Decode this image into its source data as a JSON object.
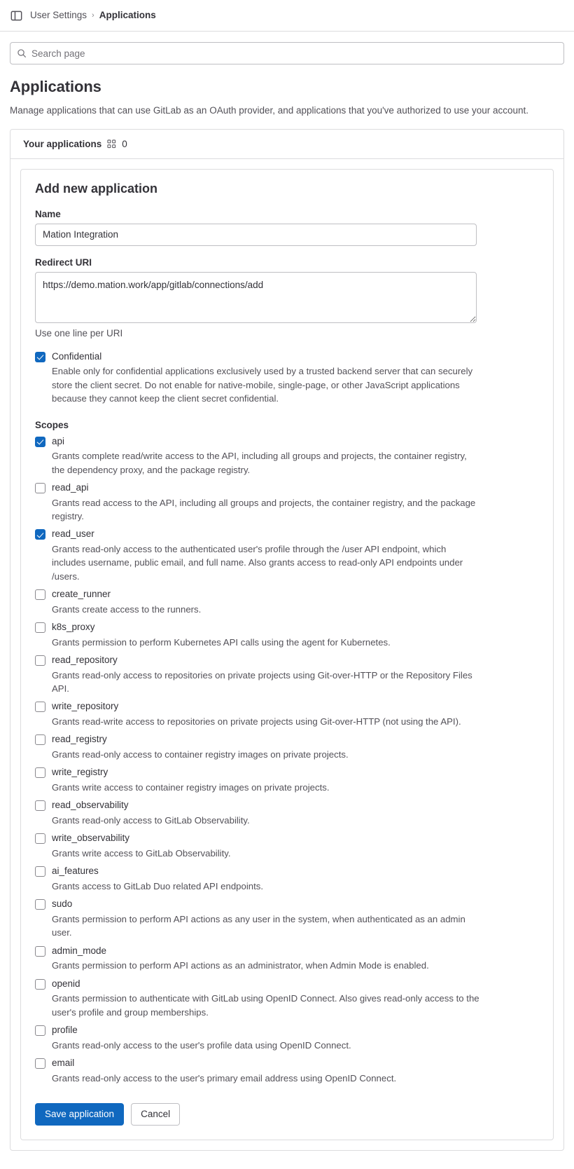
{
  "topbar": {
    "sidebar_toggle_icon": "sidebar-panel-icon",
    "breadcrumb": {
      "parent": "User Settings",
      "separator": "›",
      "current": "Applications"
    }
  },
  "search": {
    "icon": "search-icon",
    "placeholder": "Search page",
    "value": ""
  },
  "page": {
    "title": "Applications",
    "description": "Manage applications that can use GitLab as an OAuth provider, and applications that you've authorized to use your account."
  },
  "card": {
    "header_label": "Your applications",
    "header_icon": "applications-grid-icon",
    "count": "0"
  },
  "form": {
    "title": "Add new application",
    "name_label": "Name",
    "name_value": "Mation Integration",
    "name_placeholder": "",
    "redirect_label": "Redirect URI",
    "redirect_value": "https://demo.mation.work/app/gitlab/connections/add",
    "redirect_placeholder": "",
    "redirect_help": "Use one line per URI",
    "confidential": {
      "label": "Confidential",
      "checked": true,
      "description": "Enable only for confidential applications exclusively used by a trusted backend server that can securely store the client secret. Do not enable for native-mobile, single-page, or other JavaScript applications because they cannot keep the client secret confidential."
    },
    "scopes_label": "Scopes",
    "scopes": [
      {
        "name": "api",
        "checked": true,
        "description": "Grants complete read/write access to the API, including all groups and projects, the container registry, the dependency proxy, and the package registry."
      },
      {
        "name": "read_api",
        "checked": false,
        "description": "Grants read access to the API, including all groups and projects, the container registry, and the package registry."
      },
      {
        "name": "read_user",
        "checked": true,
        "description": "Grants read-only access to the authenticated user's profile through the /user API endpoint, which includes username, public email, and full name. Also grants access to read-only API endpoints under /users."
      },
      {
        "name": "create_runner",
        "checked": false,
        "description": "Grants create access to the runners."
      },
      {
        "name": "k8s_proxy",
        "checked": false,
        "description": "Grants permission to perform Kubernetes API calls using the agent for Kubernetes."
      },
      {
        "name": "read_repository",
        "checked": false,
        "description": "Grants read-only access to repositories on private projects using Git-over-HTTP or the Repository Files API."
      },
      {
        "name": "write_repository",
        "checked": false,
        "description": "Grants read-write access to repositories on private projects using Git-over-HTTP (not using the API)."
      },
      {
        "name": "read_registry",
        "checked": false,
        "description": "Grants read-only access to container registry images on private projects."
      },
      {
        "name": "write_registry",
        "checked": false,
        "description": "Grants write access to container registry images on private projects."
      },
      {
        "name": "read_observability",
        "checked": false,
        "description": "Grants read-only access to GitLab Observability."
      },
      {
        "name": "write_observability",
        "checked": false,
        "description": "Grants write access to GitLab Observability."
      },
      {
        "name": "ai_features",
        "checked": false,
        "description": "Grants access to GitLab Duo related API endpoints."
      },
      {
        "name": "sudo",
        "checked": false,
        "description": "Grants permission to perform API actions as any user in the system, when authenticated as an admin user."
      },
      {
        "name": "admin_mode",
        "checked": false,
        "description": "Grants permission to perform API actions as an administrator, when Admin Mode is enabled."
      },
      {
        "name": "openid",
        "checked": false,
        "description": "Grants permission to authenticate with GitLab using OpenID Connect. Also gives read-only access to the user's profile and group memberships."
      },
      {
        "name": "profile",
        "checked": false,
        "description": "Grants read-only access to the user's profile data using OpenID Connect."
      },
      {
        "name": "email",
        "checked": false,
        "description": "Grants read-only access to the user's primary email address using OpenID Connect."
      }
    ],
    "save_label": "Save application",
    "cancel_label": "Cancel"
  },
  "colors": {
    "accent": "#1068bf",
    "border": "#dcdcde",
    "text": "#333238",
    "muted": "#535158"
  }
}
